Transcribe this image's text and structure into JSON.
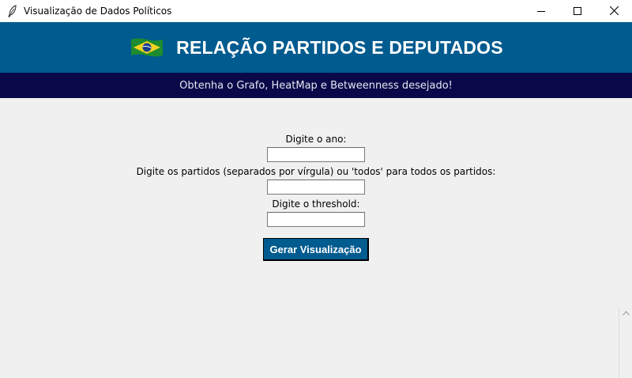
{
  "window": {
    "title": "Visualização de Dados Políticos",
    "icon": "feather-icon",
    "controls": [
      "minimize",
      "maximize",
      "close"
    ]
  },
  "header": {
    "title": "RELAÇÃO PARTIDOS E DEPUTADOS",
    "icon": "brazil-flag-icon",
    "background": "#005b8f"
  },
  "subheader": {
    "text": "Obtenha o Grafo, HeatMap e Betweenness desejado!",
    "background": "#09094a"
  },
  "form": {
    "year_label": "Digite o ano:",
    "year_value": "",
    "parties_label": "Digite os partidos (separados por vírgula) ou 'todos' para todos os partidos:",
    "parties_value": "",
    "threshold_label": "Digite o threshold:",
    "threshold_value": "",
    "submit_label": "Gerar Visualização"
  }
}
